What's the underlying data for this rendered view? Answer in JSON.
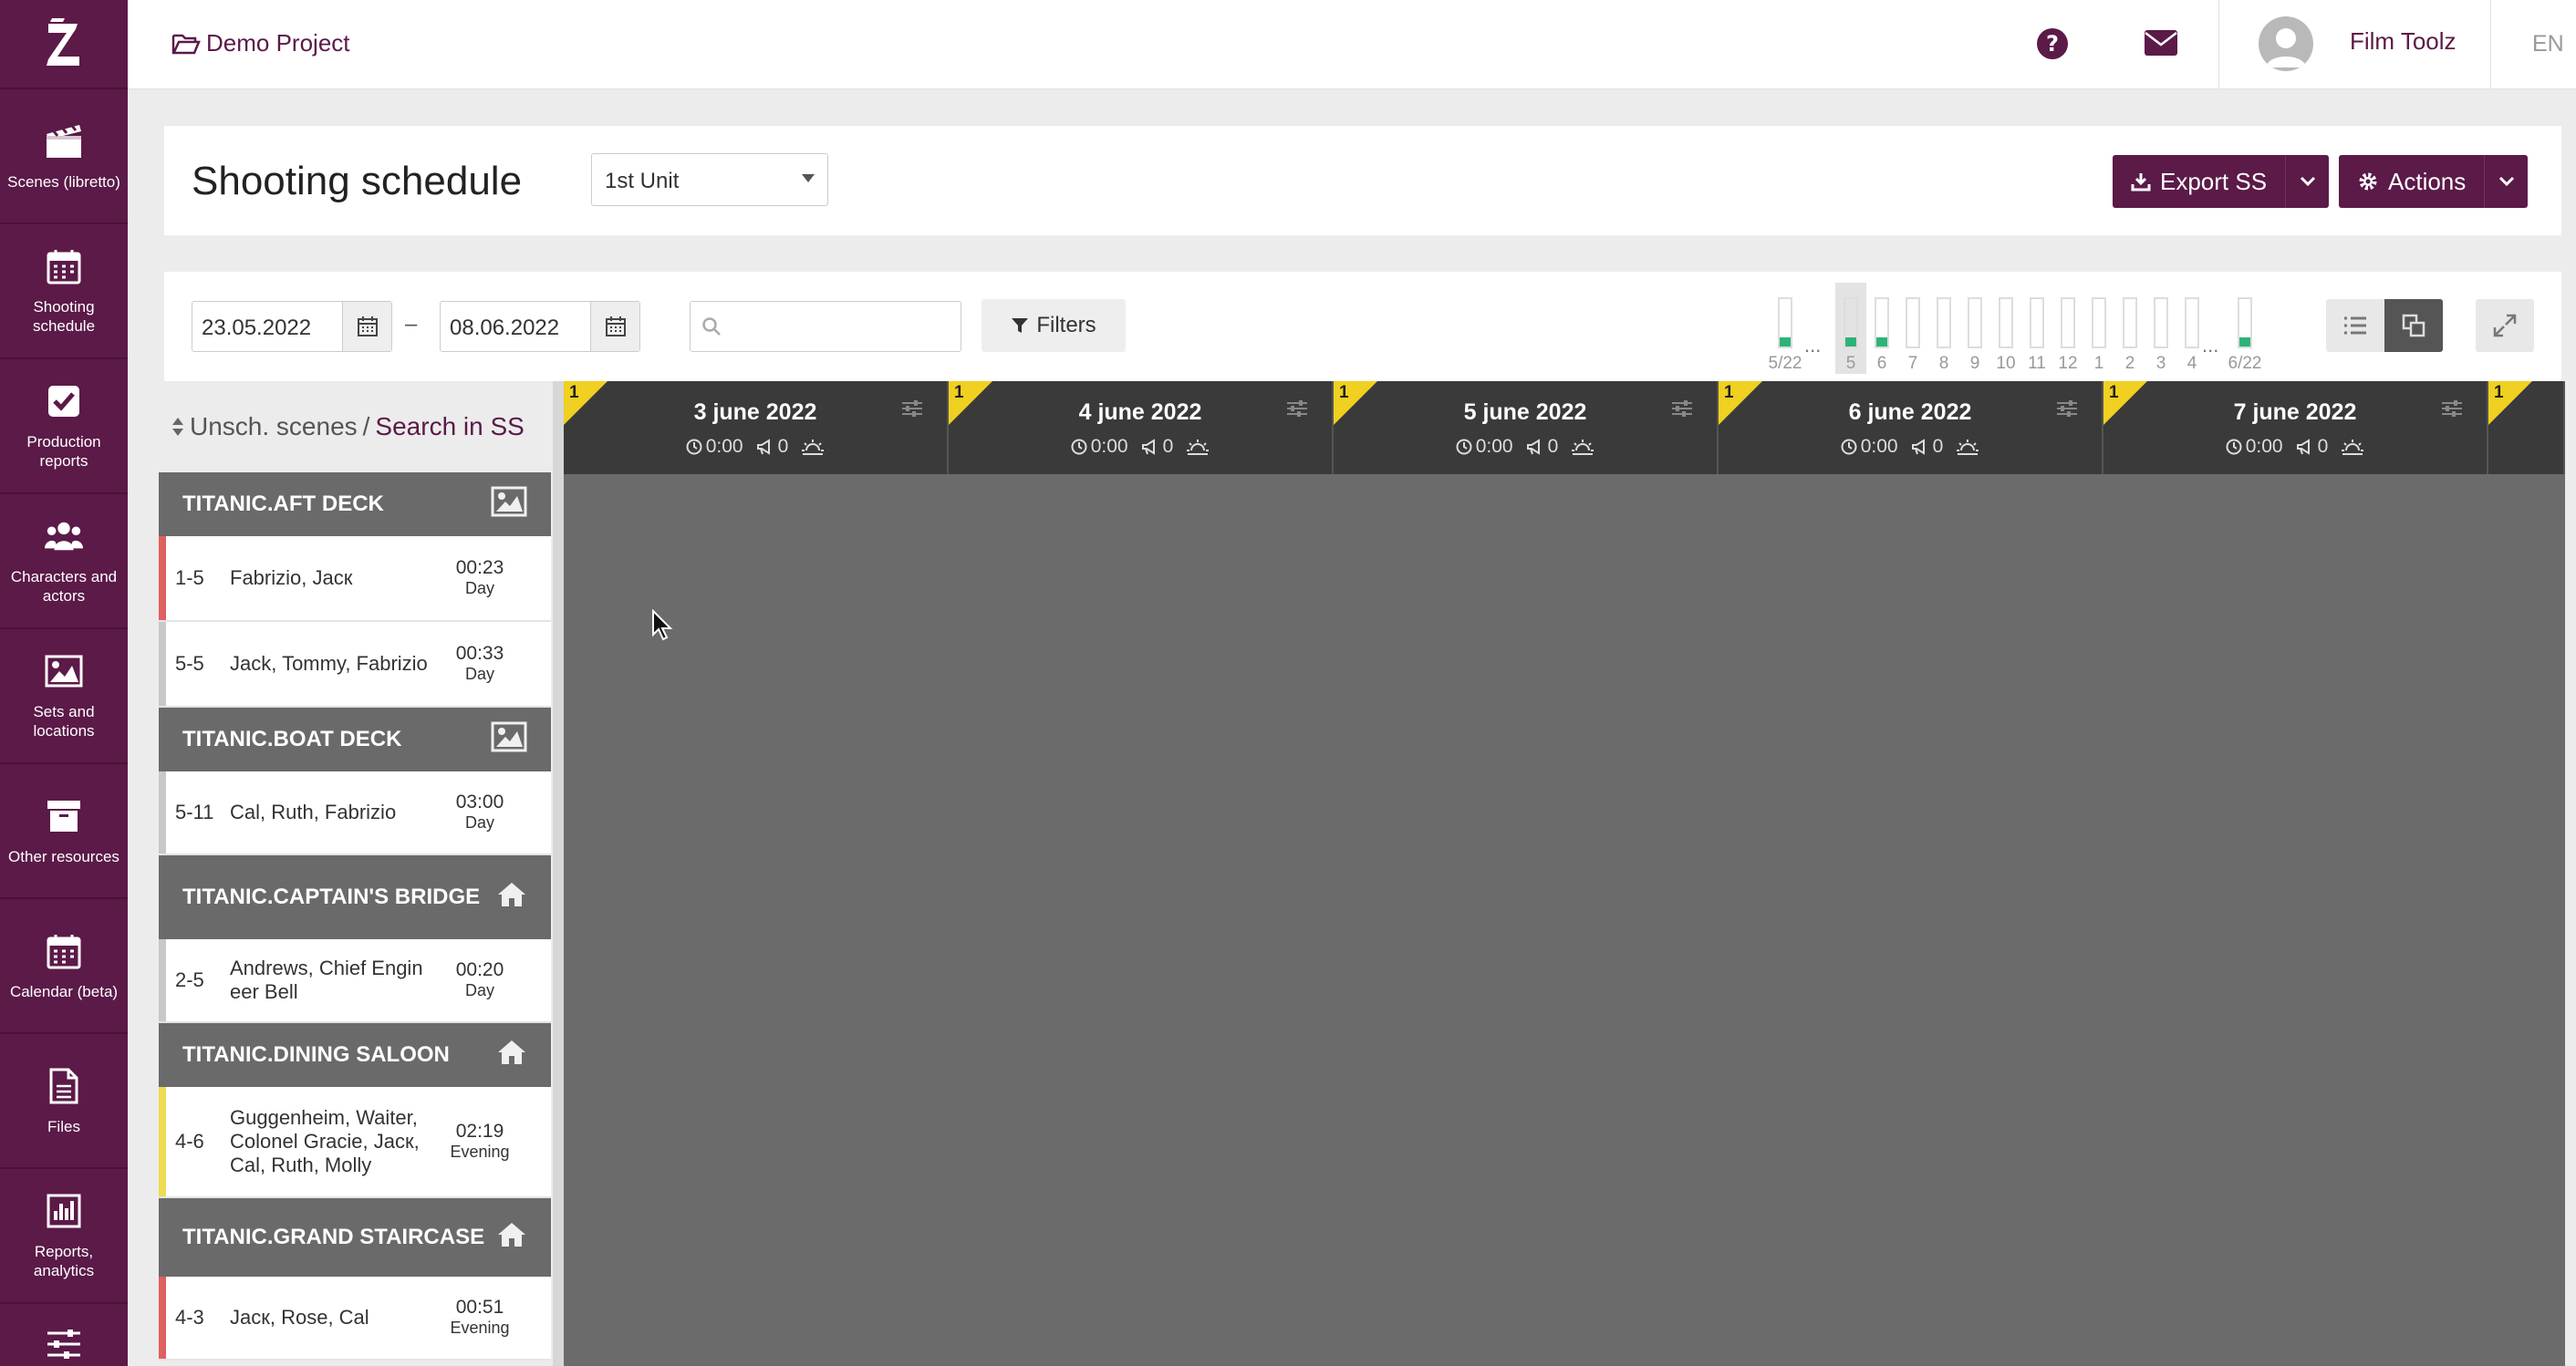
{
  "sidebar": {
    "logo": "Z",
    "items": [
      {
        "label": "Scenes (libretto)",
        "icon": "clapperboard-icon"
      },
      {
        "label": "Shooting schedule",
        "icon": "calendar-icon"
      },
      {
        "label": "Production reports",
        "icon": "checkbox-icon"
      },
      {
        "label": "Characters and actors",
        "icon": "users-icon"
      },
      {
        "label": "Sets and locations",
        "icon": "image-icon"
      },
      {
        "label": "Other resources",
        "icon": "archive-icon"
      },
      {
        "label": "Calendar (beta)",
        "icon": "calendar-icon"
      },
      {
        "label": "Files",
        "icon": "file-icon"
      },
      {
        "label": "Reports, analytics",
        "icon": "bar-chart-icon"
      }
    ]
  },
  "topbar": {
    "project": "Demo Project",
    "username": "Film Toolz",
    "lang": "EN"
  },
  "header": {
    "title": "Shooting schedule",
    "unit": "1st Unit",
    "export_label": "Export SS",
    "actions_label": "Actions"
  },
  "toolbar": {
    "date_from": "23.05.2022",
    "date_dash": "–",
    "date_to": "08.06.2022",
    "search_placeholder": "",
    "filters_label": "Filters"
  },
  "mini_calendar": {
    "start_label": "5/22",
    "end_label": "6/22",
    "ellipsis": "...",
    "days": [
      "5",
      "6",
      "7",
      "8",
      "9",
      "10",
      "11",
      "12",
      "1",
      "2",
      "3",
      "4"
    ],
    "selected": "5",
    "filled": [
      "5/22",
      "5",
      "6",
      "6/22"
    ]
  },
  "left_panel": {
    "unscheduled_label": "Unsch. scenes",
    "separator": "/",
    "search_label": "Search in SS"
  },
  "scene_groups": [
    {
      "set": "TITANIC.AFT DECK",
      "icon": "image-icon",
      "scenes": [
        {
          "id": "1-5",
          "chars": "Fabrizio, Jacк",
          "time": "00:23",
          "tod": "Day",
          "color": "#e06060"
        },
        {
          "id": "5-5",
          "chars": "Jack, Tommy, Fabrizio",
          "time": "00:33",
          "tod": "Day",
          "color": "#c8c8c8"
        }
      ]
    },
    {
      "set": "TITANIC.BOAT DECK",
      "icon": "image-icon",
      "scenes": [
        {
          "id": "5-11",
          "chars": "Cal, Ruth, Fabrizio",
          "time": "03:00",
          "tod": "Day",
          "color": "#c8c8c8"
        }
      ]
    },
    {
      "set": "TITANIC.CAPTAIN'S BRIDGE",
      "icon": "home-icon",
      "scenes": [
        {
          "id": "2-5",
          "chars": "Andrews, Chief Engineer Bell",
          "time": "00:20",
          "tod": "Day",
          "color": "#c8c8c8"
        }
      ]
    },
    {
      "set": "TITANIC.DINING SALOON",
      "icon": "home-icon",
      "scenes": [
        {
          "id": "4-6",
          "chars": "Guggenheim, Waiter, Colonel Gracie, Jacк, Cal, Ruth, Molly",
          "time": "02:19",
          "tod": "Evening",
          "color": "#eedc50"
        }
      ]
    },
    {
      "set": "TITANIC.GRAND STAIRCASE",
      "icon": "home-icon",
      "scenes": [
        {
          "id": "4-3",
          "chars": "Jacк, Rose, Cal",
          "time": "00:51",
          "tod": "Evening",
          "color": "#e06060"
        }
      ]
    }
  ],
  "days": [
    {
      "title": "3 june 2022",
      "flag": "1",
      "duration": "0:00",
      "scenes": "0"
    },
    {
      "title": "4 june 2022",
      "flag": "1",
      "duration": "0:00",
      "scenes": "0"
    },
    {
      "title": "5 june 2022",
      "flag": "1",
      "duration": "0:00",
      "scenes": "0"
    },
    {
      "title": "6 june 2022",
      "flag": "1",
      "duration": "0:00",
      "scenes": "0"
    },
    {
      "title": "7 june 2022",
      "flag": "1",
      "duration": "0:00",
      "scenes": "0"
    },
    {
      "title": "",
      "flag": "1",
      "duration": "",
      "scenes": ""
    }
  ],
  "colors": {
    "brand": "#5b1a48",
    "accent_green": "#2db37a",
    "flag_yellow": "#f0d020"
  }
}
